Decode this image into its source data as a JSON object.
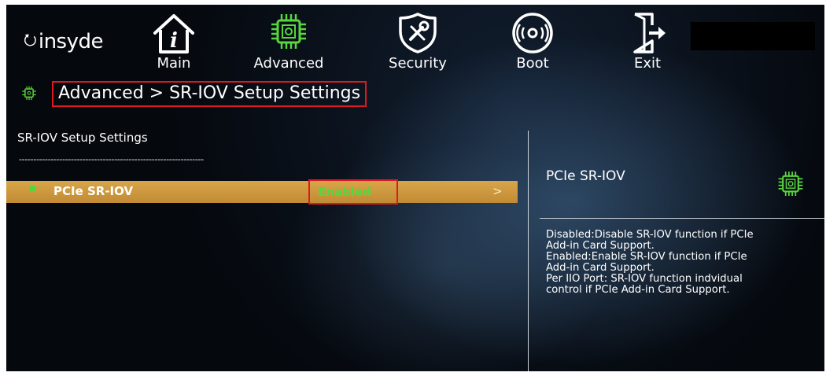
{
  "brand": {
    "name": "insyde"
  },
  "menu": {
    "items": [
      {
        "label": "Main",
        "icon": "info-house-icon"
      },
      {
        "label": "Advanced",
        "icon": "chip-icon"
      },
      {
        "label": "Security",
        "icon": "security-shield-icon"
      },
      {
        "label": "Boot",
        "icon": "disc-icon"
      },
      {
        "label": "Exit",
        "icon": "exit-door-icon"
      }
    ],
    "active": "Advanced"
  },
  "breadcrumb": "Advanced > SR-IOV Setup Settings",
  "section": {
    "title": "SR-IOV Setup Settings",
    "separator": "----------------------------------------------------------------"
  },
  "setting": {
    "label": "PCIe SR-IOV",
    "value": "Enabled",
    "arrow": ">"
  },
  "help": {
    "title": "PCIe SR-IOV",
    "text": "Disabled:Disable SR-IOV function if PCIe\nAdd-in Card Support.\nEnabled:Enable SR-IOV function if PCIe\nAdd-in Card Support.\nPer IIO Port: SR-IOV function indvidual\ncontrol if PCIe Add-in Card Support."
  },
  "colors": {
    "accent_green": "#58d63c",
    "highlight_row": "#c99538",
    "annotation_red": "#e0191f",
    "background": "#05080d"
  }
}
